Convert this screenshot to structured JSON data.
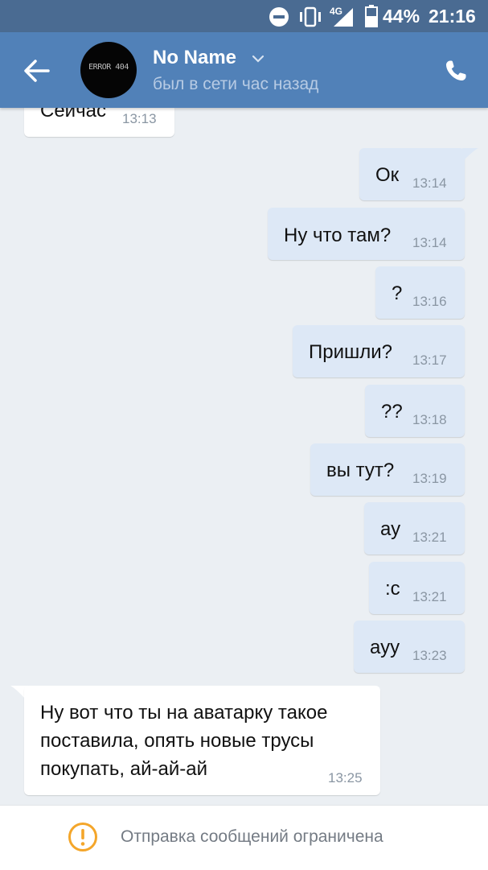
{
  "status_bar": {
    "network": "4G",
    "battery": "44%",
    "time": "21:16"
  },
  "header": {
    "contact_name": "No Name",
    "contact_status": "был в сети час назад",
    "avatar_text": "ERROR 404"
  },
  "messages": [
    {
      "direction": "in",
      "text": "Сейчас",
      "time": "13:13"
    },
    {
      "direction": "out",
      "text": "Ок",
      "time": "13:14"
    },
    {
      "direction": "out",
      "text": "Ну что там?",
      "time": "13:14"
    },
    {
      "direction": "out",
      "text": "?",
      "time": "13:16"
    },
    {
      "direction": "out",
      "text": "Пришли?",
      "time": "13:17"
    },
    {
      "direction": "out",
      "text": "??",
      "time": "13:18"
    },
    {
      "direction": "out",
      "text": "вы тут?",
      "time": "13:19"
    },
    {
      "direction": "out",
      "text": "ау",
      "time": "13:21"
    },
    {
      "direction": "out",
      "text": ":с",
      "time": "13:21"
    },
    {
      "direction": "out",
      "text": "ауу",
      "time": "13:23"
    },
    {
      "direction": "in",
      "lines": [
        "Ну вот что ты на аватарку такое",
        "поставила, опять новые трусы",
        "покупать, ай-ай-ай"
      ],
      "time": "13:25"
    }
  ],
  "footer": {
    "notice": "Отправка сообщений ограничена"
  },
  "colors": {
    "header": "#5181b8",
    "status_bar": "#4a6b92",
    "chat_background": "#ebeff3",
    "outgoing_bubble": "#dde8f6",
    "incoming_bubble": "#ffffff",
    "warning": "#f4a62a"
  },
  "icons": [
    "dnd-icon",
    "vibrate-icon",
    "signal-icon",
    "battery-icon",
    "back-arrow-icon",
    "chevron-down-icon",
    "phone-icon",
    "warning-icon"
  ]
}
